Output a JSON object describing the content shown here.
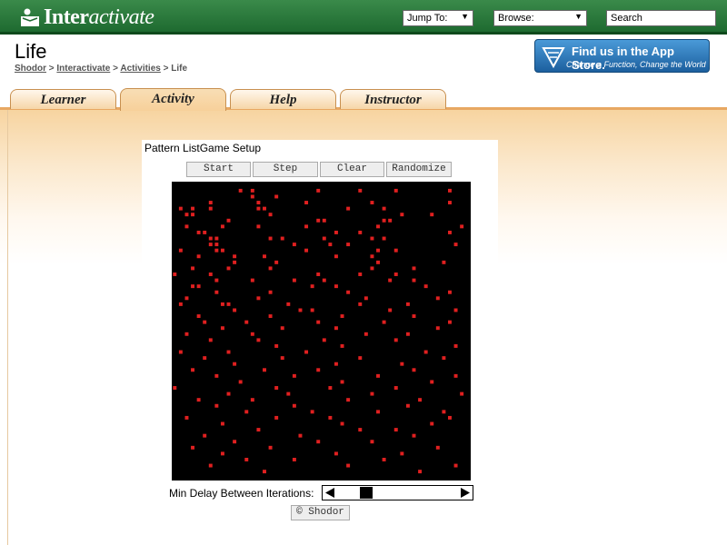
{
  "header": {
    "logo": {
      "prefix": "Inter",
      "suffix": "activate"
    },
    "jump_to": "Jump To:",
    "browse": "Browse:",
    "search_placeholder": "Search"
  },
  "page": {
    "title": "Life",
    "breadcrumbs": [
      "Shodor",
      "Interactivate",
      "Activities",
      "Life"
    ],
    "breadcrumb_sep": ">"
  },
  "appstore": {
    "line1": "Find us in the App Store.",
    "line2": "Change a Function, Change the World"
  },
  "tabs": [
    {
      "label": "Learner",
      "active": false
    },
    {
      "label": "Activity",
      "active": true
    },
    {
      "label": "Help",
      "active": false
    },
    {
      "label": "Instructor",
      "active": false
    }
  ],
  "applet": {
    "menus": [
      "Pattern List",
      "Game Setup"
    ],
    "buttons": [
      "Start",
      "Step",
      "Clear",
      "Randomize"
    ],
    "delay_label": "Min Delay Between Iterations:",
    "delay_fraction": 0.2,
    "credit_button": "© Shodor",
    "grid": {
      "rows": 50,
      "cols": 50,
      "background": "#000000",
      "live_color": "#e02020",
      "live_cells": [
        [
          1,
          11
        ],
        [
          1,
          13
        ],
        [
          1,
          24
        ],
        [
          1,
          31
        ],
        [
          1,
          37
        ],
        [
          1,
          46
        ],
        [
          2,
          13
        ],
        [
          2,
          17
        ],
        [
          3,
          6
        ],
        [
          3,
          14
        ],
        [
          3,
          22
        ],
        [
          3,
          33
        ],
        [
          3,
          46
        ],
        [
          4,
          1
        ],
        [
          4,
          3
        ],
        [
          4,
          6
        ],
        [
          4,
          14
        ],
        [
          4,
          15
        ],
        [
          4,
          29
        ],
        [
          4,
          35
        ],
        [
          5,
          2
        ],
        [
          5,
          3
        ],
        [
          5,
          16
        ],
        [
          5,
          38
        ],
        [
          5,
          43
        ],
        [
          6,
          9
        ],
        [
          6,
          24
        ],
        [
          6,
          25
        ],
        [
          6,
          35
        ],
        [
          6,
          36
        ],
        [
          7,
          2
        ],
        [
          7,
          8
        ],
        [
          7,
          14
        ],
        [
          7,
          22
        ],
        [
          7,
          34
        ],
        [
          7,
          48
        ],
        [
          8,
          4
        ],
        [
          8,
          5
        ],
        [
          8,
          27
        ],
        [
          8,
          31
        ],
        [
          8,
          46
        ],
        [
          9,
          6
        ],
        [
          9,
          7
        ],
        [
          9,
          16
        ],
        [
          9,
          18
        ],
        [
          9,
          25
        ],
        [
          9,
          33
        ],
        [
          9,
          35
        ],
        [
          10,
          6
        ],
        [
          10,
          7
        ],
        [
          10,
          20
        ],
        [
          10,
          26
        ],
        [
          10,
          29
        ],
        [
          10,
          47
        ],
        [
          11,
          1
        ],
        [
          11,
          7
        ],
        [
          11,
          8
        ],
        [
          11,
          22
        ],
        [
          11,
          34
        ],
        [
          11,
          37
        ],
        [
          12,
          4
        ],
        [
          12,
          10
        ],
        [
          12,
          15
        ],
        [
          12,
          27
        ],
        [
          12,
          33
        ],
        [
          13,
          10
        ],
        [
          13,
          17
        ],
        [
          13,
          34
        ],
        [
          13,
          45
        ],
        [
          14,
          3
        ],
        [
          14,
          9
        ],
        [
          14,
          16
        ],
        [
          14,
          33
        ],
        [
          14,
          40
        ],
        [
          15,
          0
        ],
        [
          15,
          6
        ],
        [
          15,
          24
        ],
        [
          15,
          31
        ],
        [
          15,
          37
        ],
        [
          16,
          7
        ],
        [
          16,
          13
        ],
        [
          16,
          20
        ],
        [
          16,
          25
        ],
        [
          16,
          36
        ],
        [
          16,
          40
        ],
        [
          17,
          3
        ],
        [
          17,
          4
        ],
        [
          17,
          23
        ],
        [
          17,
          27
        ],
        [
          17,
          42
        ],
        [
          18,
          7
        ],
        [
          18,
          16
        ],
        [
          18,
          29
        ],
        [
          18,
          46
        ],
        [
          19,
          2
        ],
        [
          19,
          14
        ],
        [
          19,
          32
        ],
        [
          19,
          44
        ],
        [
          20,
          1
        ],
        [
          20,
          8
        ],
        [
          20,
          9
        ],
        [
          20,
          19
        ],
        [
          20,
          31
        ],
        [
          20,
          39
        ],
        [
          21,
          10
        ],
        [
          21,
          21
        ],
        [
          21,
          23
        ],
        [
          21,
          36
        ],
        [
          21,
          47
        ],
        [
          22,
          4
        ],
        [
          22,
          16
        ],
        [
          22,
          28
        ],
        [
          22,
          40
        ],
        [
          23,
          5
        ],
        [
          23,
          12
        ],
        [
          23,
          24
        ],
        [
          23,
          35
        ],
        [
          23,
          46
        ],
        [
          24,
          8
        ],
        [
          24,
          18
        ],
        [
          24,
          27
        ],
        [
          24,
          44
        ],
        [
          25,
          2
        ],
        [
          25,
          13
        ],
        [
          25,
          32
        ],
        [
          25,
          39
        ],
        [
          26,
          6
        ],
        [
          26,
          14
        ],
        [
          26,
          25
        ],
        [
          26,
          37
        ],
        [
          27,
          17
        ],
        [
          27,
          28
        ],
        [
          27,
          47
        ],
        [
          28,
          1
        ],
        [
          28,
          9
        ],
        [
          28,
          22
        ],
        [
          28,
          42
        ],
        [
          29,
          5
        ],
        [
          29,
          18
        ],
        [
          29,
          31
        ],
        [
          29,
          45
        ],
        [
          30,
          10
        ],
        [
          30,
          27
        ],
        [
          30,
          38
        ],
        [
          31,
          3
        ],
        [
          31,
          15
        ],
        [
          31,
          24
        ],
        [
          31,
          40
        ],
        [
          32,
          7
        ],
        [
          32,
          20
        ],
        [
          32,
          34
        ],
        [
          32,
          47
        ],
        [
          33,
          11
        ],
        [
          33,
          28
        ],
        [
          33,
          43
        ],
        [
          34,
          0
        ],
        [
          34,
          17
        ],
        [
          34,
          26
        ],
        [
          34,
          37
        ],
        [
          35,
          9
        ],
        [
          35,
          19
        ],
        [
          35,
          33
        ],
        [
          35,
          48
        ],
        [
          36,
          4
        ],
        [
          36,
          13
        ],
        [
          36,
          29
        ],
        [
          36,
          41
        ],
        [
          37,
          7
        ],
        [
          37,
          20
        ],
        [
          37,
          39
        ],
        [
          38,
          12
        ],
        [
          38,
          23
        ],
        [
          38,
          34
        ],
        [
          38,
          45
        ],
        [
          39,
          2
        ],
        [
          39,
          17
        ],
        [
          39,
          26
        ],
        [
          39,
          46
        ],
        [
          40,
          8
        ],
        [
          40,
          28
        ],
        [
          40,
          43
        ],
        [
          41,
          14
        ],
        [
          41,
          31
        ],
        [
          41,
          37
        ],
        [
          42,
          5
        ],
        [
          42,
          21
        ],
        [
          42,
          40
        ],
        [
          43,
          10
        ],
        [
          43,
          24
        ],
        [
          43,
          33
        ],
        [
          44,
          3
        ],
        [
          44,
          16
        ],
        [
          44,
          44
        ],
        [
          45,
          8
        ],
        [
          45,
          27
        ],
        [
          45,
          38
        ],
        [
          46,
          12
        ],
        [
          46,
          20
        ],
        [
          46,
          35
        ],
        [
          47,
          6
        ],
        [
          47,
          29
        ],
        [
          47,
          47
        ],
        [
          48,
          15
        ],
        [
          48,
          41
        ]
      ]
    }
  }
}
